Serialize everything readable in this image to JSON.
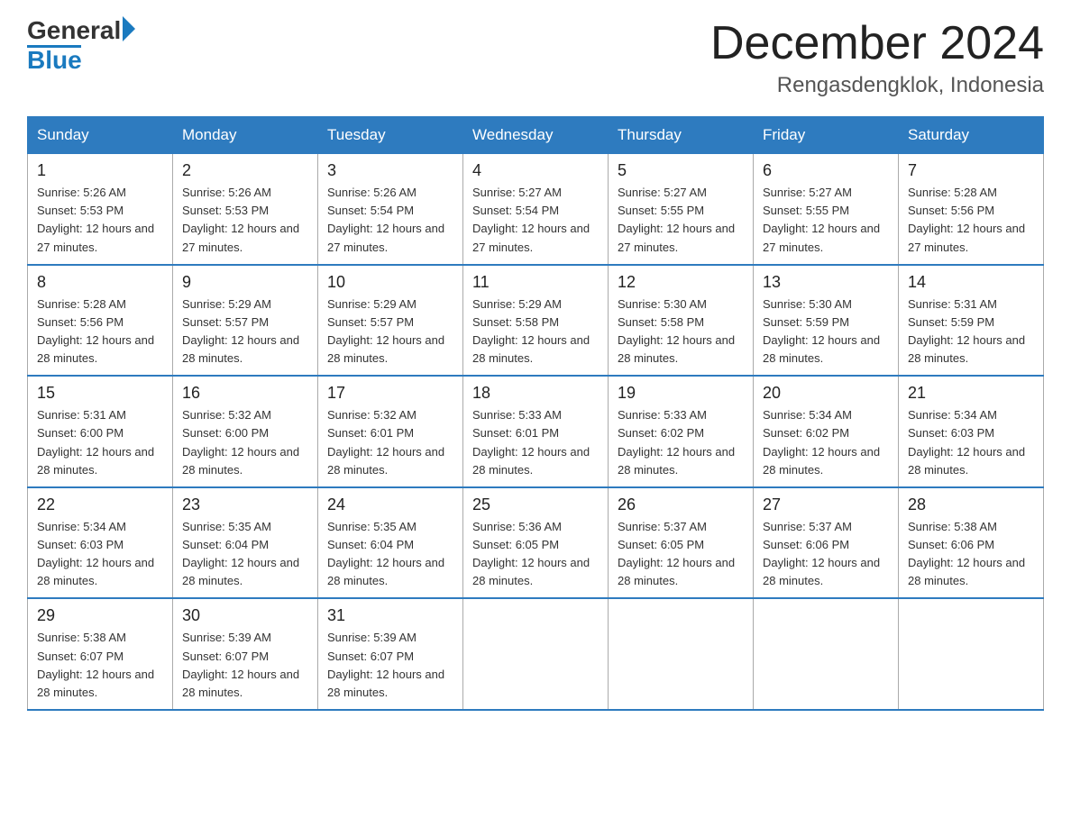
{
  "header": {
    "logo": {
      "general": "General",
      "arrow": "▶",
      "blue": "Blue"
    },
    "title": "December 2024",
    "subtitle": "Rengasdengklok, Indonesia"
  },
  "days_of_week": [
    "Sunday",
    "Monday",
    "Tuesday",
    "Wednesday",
    "Thursday",
    "Friday",
    "Saturday"
  ],
  "weeks": [
    [
      {
        "day": "1",
        "sunrise": "5:26 AM",
        "sunset": "5:53 PM",
        "daylight": "12 hours and 27 minutes."
      },
      {
        "day": "2",
        "sunrise": "5:26 AM",
        "sunset": "5:53 PM",
        "daylight": "12 hours and 27 minutes."
      },
      {
        "day": "3",
        "sunrise": "5:26 AM",
        "sunset": "5:54 PM",
        "daylight": "12 hours and 27 minutes."
      },
      {
        "day": "4",
        "sunrise": "5:27 AM",
        "sunset": "5:54 PM",
        "daylight": "12 hours and 27 minutes."
      },
      {
        "day": "5",
        "sunrise": "5:27 AM",
        "sunset": "5:55 PM",
        "daylight": "12 hours and 27 minutes."
      },
      {
        "day": "6",
        "sunrise": "5:27 AM",
        "sunset": "5:55 PM",
        "daylight": "12 hours and 27 minutes."
      },
      {
        "day": "7",
        "sunrise": "5:28 AM",
        "sunset": "5:56 PM",
        "daylight": "12 hours and 27 minutes."
      }
    ],
    [
      {
        "day": "8",
        "sunrise": "5:28 AM",
        "sunset": "5:56 PM",
        "daylight": "12 hours and 28 minutes."
      },
      {
        "day": "9",
        "sunrise": "5:29 AM",
        "sunset": "5:57 PM",
        "daylight": "12 hours and 28 minutes."
      },
      {
        "day": "10",
        "sunrise": "5:29 AM",
        "sunset": "5:57 PM",
        "daylight": "12 hours and 28 minutes."
      },
      {
        "day": "11",
        "sunrise": "5:29 AM",
        "sunset": "5:58 PM",
        "daylight": "12 hours and 28 minutes."
      },
      {
        "day": "12",
        "sunrise": "5:30 AM",
        "sunset": "5:58 PM",
        "daylight": "12 hours and 28 minutes."
      },
      {
        "day": "13",
        "sunrise": "5:30 AM",
        "sunset": "5:59 PM",
        "daylight": "12 hours and 28 minutes."
      },
      {
        "day": "14",
        "sunrise": "5:31 AM",
        "sunset": "5:59 PM",
        "daylight": "12 hours and 28 minutes."
      }
    ],
    [
      {
        "day": "15",
        "sunrise": "5:31 AM",
        "sunset": "6:00 PM",
        "daylight": "12 hours and 28 minutes."
      },
      {
        "day": "16",
        "sunrise": "5:32 AM",
        "sunset": "6:00 PM",
        "daylight": "12 hours and 28 minutes."
      },
      {
        "day": "17",
        "sunrise": "5:32 AM",
        "sunset": "6:01 PM",
        "daylight": "12 hours and 28 minutes."
      },
      {
        "day": "18",
        "sunrise": "5:33 AM",
        "sunset": "6:01 PM",
        "daylight": "12 hours and 28 minutes."
      },
      {
        "day": "19",
        "sunrise": "5:33 AM",
        "sunset": "6:02 PM",
        "daylight": "12 hours and 28 minutes."
      },
      {
        "day": "20",
        "sunrise": "5:34 AM",
        "sunset": "6:02 PM",
        "daylight": "12 hours and 28 minutes."
      },
      {
        "day": "21",
        "sunrise": "5:34 AM",
        "sunset": "6:03 PM",
        "daylight": "12 hours and 28 minutes."
      }
    ],
    [
      {
        "day": "22",
        "sunrise": "5:34 AM",
        "sunset": "6:03 PM",
        "daylight": "12 hours and 28 minutes."
      },
      {
        "day": "23",
        "sunrise": "5:35 AM",
        "sunset": "6:04 PM",
        "daylight": "12 hours and 28 minutes."
      },
      {
        "day": "24",
        "sunrise": "5:35 AM",
        "sunset": "6:04 PM",
        "daylight": "12 hours and 28 minutes."
      },
      {
        "day": "25",
        "sunrise": "5:36 AM",
        "sunset": "6:05 PM",
        "daylight": "12 hours and 28 minutes."
      },
      {
        "day": "26",
        "sunrise": "5:37 AM",
        "sunset": "6:05 PM",
        "daylight": "12 hours and 28 minutes."
      },
      {
        "day": "27",
        "sunrise": "5:37 AM",
        "sunset": "6:06 PM",
        "daylight": "12 hours and 28 minutes."
      },
      {
        "day": "28",
        "sunrise": "5:38 AM",
        "sunset": "6:06 PM",
        "daylight": "12 hours and 28 minutes."
      }
    ],
    [
      {
        "day": "29",
        "sunrise": "5:38 AM",
        "sunset": "6:07 PM",
        "daylight": "12 hours and 28 minutes."
      },
      {
        "day": "30",
        "sunrise": "5:39 AM",
        "sunset": "6:07 PM",
        "daylight": "12 hours and 28 minutes."
      },
      {
        "day": "31",
        "sunrise": "5:39 AM",
        "sunset": "6:07 PM",
        "daylight": "12 hours and 28 minutes."
      },
      null,
      null,
      null,
      null
    ]
  ]
}
